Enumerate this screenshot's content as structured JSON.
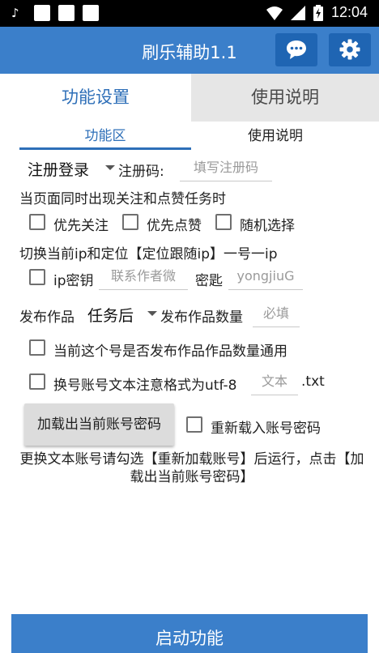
{
  "status_bar": {
    "time": "12:04"
  },
  "app_bar": {
    "title": "刷乐辅助1.1",
    "icons": [
      "chat-icon",
      "gear-icon"
    ]
  },
  "top_tabs": [
    {
      "label": "功能设置",
      "active": true
    },
    {
      "label": "使用说明",
      "active": false
    }
  ],
  "sub_tabs": [
    {
      "label": "功能区",
      "active": true
    },
    {
      "label": "使用说明",
      "active": false
    }
  ],
  "row_login": {
    "spinner_value": "注册登录",
    "code_label": "注册码:",
    "code_placeholder": "填写注册码"
  },
  "task_prompt": "当页面同时出现关注和点赞任务时",
  "priority_options": [
    {
      "label": "优先关注",
      "checked": false
    },
    {
      "label": "优先点赞",
      "checked": false
    },
    {
      "label": "随机选择",
      "checked": false
    }
  ],
  "ip_prompt": "切换当前ip和定位【定位跟随ip】一号一ip",
  "ip_row": {
    "checkbox_label": "ip密钥",
    "key_placeholder": "联系作者微",
    "password_label": "密匙",
    "password_placeholder": "yongjiuG"
  },
  "publish_row": {
    "label": "发布作品",
    "spinner_value": "任务后",
    "count_label": "发布作品数量",
    "count_placeholder": "必填"
  },
  "common_option": {
    "label": "当前这个号是否发布作品作品数量通用",
    "checked": false
  },
  "switch_option": {
    "label": "换号账号文本注意格式为utf-8",
    "file_placeholder": "文本",
    "extension": ".txt",
    "checked": false
  },
  "load_button_label": "加载出当前账号密码",
  "reload_option": {
    "label": "重新载入账号密码",
    "checked": false
  },
  "note": "更换文本账号请勾选【重新加载账号】后运行，点击【加载出当前账号密码】",
  "start_button_label": "启动功能",
  "colors": {
    "primary": "#3b7fca",
    "primary_dark": "#1f65b3",
    "accent_text": "#2e6fb8"
  }
}
